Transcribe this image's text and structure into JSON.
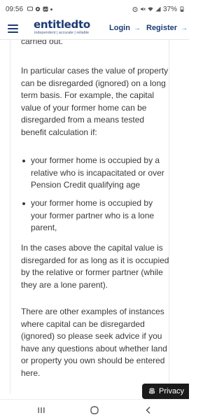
{
  "status_bar": {
    "time": "09:56",
    "battery": "37%"
  },
  "header": {
    "logo_text": "entitledto",
    "logo_tagline": "independent | accurate | reliable",
    "login_label": "Login",
    "register_label": "Register",
    "arrow": "→"
  },
  "article": {
    "partial_top": "carried out.",
    "para1": "In particular cases the value of property can be disregarded (ignored) on a long term basis. For example, the capital value of your former home can be disregarded from a means tested benefit calculation if:",
    "bullets": [
      "your former home is occupied by a relative who is incapacitated or over Pension Credit qualifying age",
      "your former home is occupied by your former partner who is a lone parent,"
    ],
    "para2": "In the cases above the capital value is disregarded for as long as it is occupied by the relative or former partner (while they are a lone parent).",
    "para3": "There are other examples of instances where capital can be disregarded (ignored) so please seek advice if you have any questions about whether land or property you own should be entered here."
  },
  "privacy": {
    "label": "Privacy"
  },
  "colors": {
    "brand_navy": "#1c3b74",
    "arrow_blue": "#1c8fcf",
    "body_text": "#3a3a3a",
    "privacy_bg": "#1b1b1b"
  },
  "icons": {
    "menu": "hamburger-icon",
    "privacy": "fingerprint-icon",
    "nav_recent": "recent-apps-icon",
    "nav_home": "home-icon",
    "nav_back": "back-icon"
  }
}
